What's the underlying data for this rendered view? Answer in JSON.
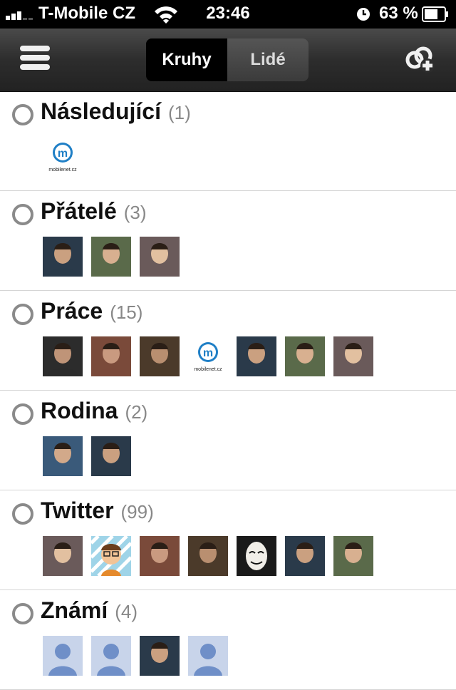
{
  "status": {
    "carrier": "T-Mobile CZ",
    "time": "23:46",
    "battery": "63 %"
  },
  "nav": {
    "menu_icon": "hamburger-menu-icon",
    "tabs": [
      {
        "label": "Kruhy",
        "active": true
      },
      {
        "label": "Lidé",
        "active": false
      }
    ],
    "add_icon": "add-circle-icon"
  },
  "circles": [
    {
      "title": "Následující",
      "count": "(1)",
      "avatars": [
        "logo"
      ]
    },
    {
      "title": "Přátelé",
      "count": "(3)",
      "avatars": [
        "photo",
        "photo",
        "photo"
      ]
    },
    {
      "title": "Práce",
      "count": "(15)",
      "avatars": [
        "photo",
        "photo",
        "photo",
        "logo",
        "photo",
        "photo",
        "photo"
      ]
    },
    {
      "title": "Rodina",
      "count": "(2)",
      "avatars": [
        "photo",
        "photo"
      ]
    },
    {
      "title": "Twitter",
      "count": "(99)",
      "avatars": [
        "photo",
        "cartoon",
        "photo",
        "photo",
        "mask",
        "photo",
        "photo"
      ]
    },
    {
      "title": "Známí",
      "count": "(4)",
      "avatars": [
        "default",
        "default",
        "photo",
        "default"
      ]
    }
  ],
  "colors": {
    "navbar": "#2d2d2d",
    "active_tab": "#000000",
    "count": "#888888",
    "default_avatar": "#c8d4ea"
  },
  "logo_text": "mobilenet.cz"
}
